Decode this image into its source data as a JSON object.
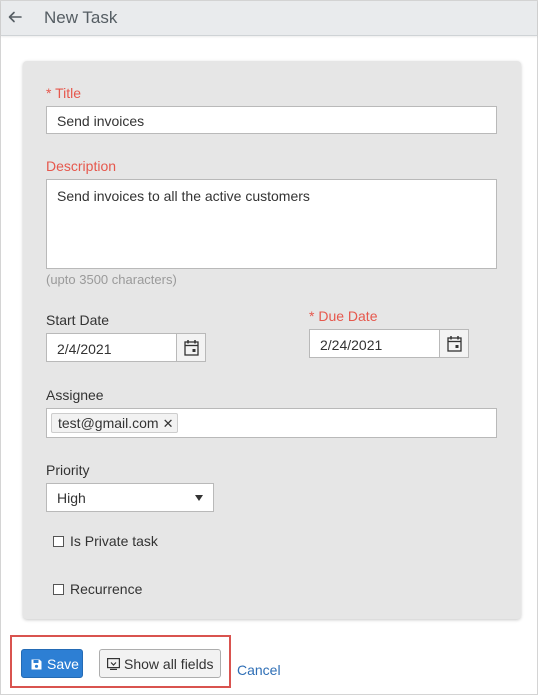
{
  "header": {
    "title": "New Task",
    "back_icon": "arrow-left-icon"
  },
  "form": {
    "title": {
      "label": "* Title",
      "value": "Send invoices"
    },
    "description": {
      "label": "Description",
      "value": "Send invoices to all the active customers",
      "hint": "(upto 3500 characters)"
    },
    "start_date": {
      "label": "Start Date",
      "value": "2/4/2021"
    },
    "due_date": {
      "label": "* Due Date",
      "value": "2/24/2021"
    },
    "assignee": {
      "label": "Assignee",
      "tags": [
        "test@gmail.com"
      ]
    },
    "priority": {
      "label": "Priority",
      "selected": "High"
    },
    "is_private": {
      "label": "Is Private task",
      "checked": false
    },
    "recurrence": {
      "label": "Recurrence",
      "checked": false
    }
  },
  "actions": {
    "save_label": "Save",
    "show_all_label": "Show all fields",
    "cancel_label": "Cancel"
  },
  "colors": {
    "required": "#e6584d",
    "primary": "#2d7fd4",
    "link": "#2f6fb6",
    "highlight": "#d9534f",
    "card": "#e6e6e6"
  }
}
